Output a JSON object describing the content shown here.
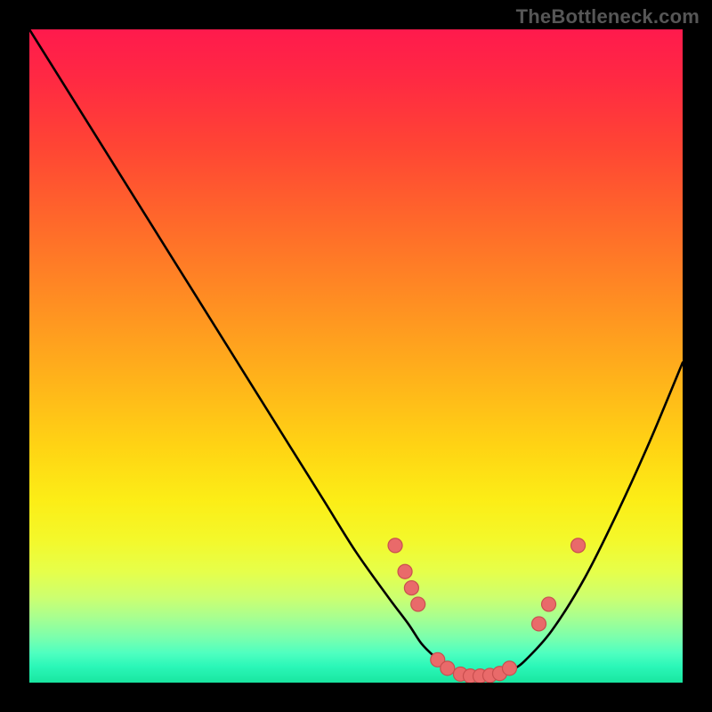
{
  "attribution": "TheBottleneck.com",
  "colors": {
    "background": "#000000",
    "gradient_top": "#ff1a4d",
    "gradient_bottom": "#19e6a0",
    "curve": "#000000",
    "dot_fill": "#e96a6a",
    "dot_stroke": "#c94f4f"
  },
  "chart_data": {
    "type": "line",
    "title": "",
    "xlabel": "",
    "ylabel": "",
    "xlim": [
      0,
      100
    ],
    "ylim": [
      0,
      100
    ],
    "series": [
      {
        "name": "bottleneck-curve",
        "x": [
          0,
          5,
          10,
          15,
          20,
          25,
          30,
          35,
          40,
          45,
          50,
          55,
          58,
          60,
          62,
          64,
          66,
          68,
          70,
          72,
          74,
          76,
          80,
          85,
          90,
          95,
          100
        ],
        "y": [
          100,
          92,
          84,
          76,
          68,
          60,
          52,
          44,
          36,
          28,
          20,
          13,
          9,
          6,
          4,
          2.5,
          1.5,
          1,
          1,
          1.2,
          2,
          3.5,
          8,
          16,
          26,
          37,
          49
        ]
      }
    ],
    "markers": [
      {
        "x": 56,
        "y": 21
      },
      {
        "x": 57.5,
        "y": 17
      },
      {
        "x": 58.5,
        "y": 14.5
      },
      {
        "x": 59.5,
        "y": 12
      },
      {
        "x": 62.5,
        "y": 3.5
      },
      {
        "x": 64,
        "y": 2.2
      },
      {
        "x": 66,
        "y": 1.3
      },
      {
        "x": 67.5,
        "y": 1
      },
      {
        "x": 69,
        "y": 1
      },
      {
        "x": 70.5,
        "y": 1.1
      },
      {
        "x": 72,
        "y": 1.4
      },
      {
        "x": 73.5,
        "y": 2.2
      },
      {
        "x": 78,
        "y": 9
      },
      {
        "x": 79.5,
        "y": 12
      },
      {
        "x": 84,
        "y": 21
      }
    ],
    "marker_radius": 8
  }
}
